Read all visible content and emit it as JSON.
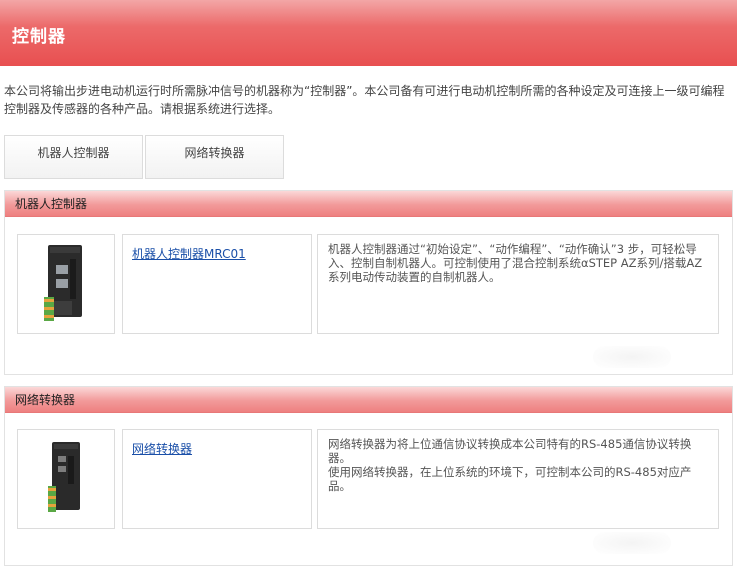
{
  "header": {
    "title": "控制器"
  },
  "intro": {
    "text": "本公司将输出步进电动机运行时所需脉冲信号的机器称为“控制器”。本公司备有可进行电动机控制所需的各种设定及可连接上一级可编程控制器及传感器的各种产品。请根据系统进行选择。"
  },
  "tabs": [
    {
      "label": "机器人控制器"
    },
    {
      "label": "网络转换器"
    }
  ],
  "sections": [
    {
      "title": "机器人控制器",
      "product": {
        "name": "机器人控制器MRC01",
        "description": "机器人控制器通过“初始设定”、“动作编程”、“动作确认”3 步，可轻松导 入、控制自制机器人。可控制使用了混合控制系统αSTEP AZ系列/搭载AZ系列电动传动装置的自制机器人。"
      }
    },
    {
      "title": "网络转换器",
      "product": {
        "name": "网络转换器",
        "description": "网络转换器为将上位通信协议转换成本公司特有的RS-485通信协议转换器。\n使用网络转换器，在上位系统的环境下，可控制本公司的RS-485对应产品。"
      }
    }
  ],
  "icons": {
    "product_1": "robot-controller-device-image",
    "product_2": "network-converter-device-image"
  }
}
